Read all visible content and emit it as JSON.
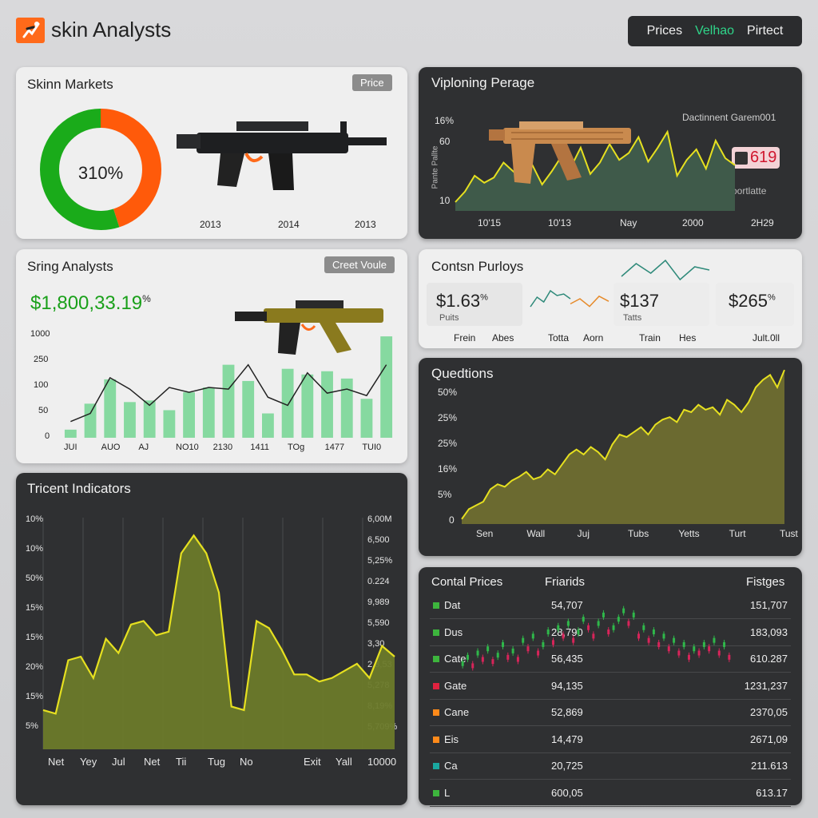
{
  "header": {
    "app_title": "skin Analysts",
    "logo_icon": "runner-logo-icon",
    "nav": [
      {
        "label": "Prices",
        "active": false
      },
      {
        "label": "Velhao",
        "active": true
      },
      {
        "label": "Pirtect",
        "active": false
      }
    ]
  },
  "skin_markets": {
    "title": "Skinn Markets",
    "button_label": "Price",
    "donut_value": "310%",
    "donut_segments": [
      {
        "name": "orange",
        "fraction": 0.45,
        "color": "#ff5a0a"
      },
      {
        "name": "green",
        "fraction": 0.55,
        "color": "#1aab1a"
      }
    ],
    "x_labels": [
      "2013",
      "2014",
      "2013"
    ]
  },
  "viploning": {
    "title": "Viploning Perage",
    "legend": "Dactinnent Garem001",
    "badge_value": "619",
    "sublabel": "Poortlatte",
    "vertical_label": "Pante Pallte",
    "y_ticks": [
      "16%",
      "60",
      "10"
    ],
    "x_ticks": [
      "10'15",
      "10'13",
      "Nay",
      "2000",
      "2H29"
    ],
    "values": [
      10,
      22,
      40,
      32,
      38,
      55,
      45,
      36,
      52,
      30,
      45,
      62,
      50,
      72,
      42,
      55,
      76,
      58,
      66,
      84,
      56,
      72,
      90,
      40,
      58,
      70,
      48,
      80,
      60,
      52
    ]
  },
  "string_analysts": {
    "title": "Sring Analysts",
    "button_label": "Creet Voule",
    "big_value": "$1,800,33.19",
    "big_value_suffix": "%",
    "y_ticks": [
      "1000",
      "250",
      "100",
      "50",
      "0"
    ],
    "x_ticks": [
      "JUI",
      "AUO",
      "AJ",
      "NO10",
      "2130",
      "1411",
      "TOg",
      "1477",
      "TUI0"
    ],
    "bars": [
      10,
      42,
      72,
      44,
      46,
      34,
      56,
      62,
      90,
      70,
      30,
      85,
      78,
      82,
      73,
      48,
      125
    ],
    "line": [
      20,
      30,
      74,
      60,
      40,
      62,
      56,
      62,
      60,
      90,
      50,
      40,
      80,
      55,
      60,
      52,
      90
    ]
  },
  "contsn_purloys": {
    "title": "Contsn Purloys",
    "stats": [
      {
        "value": "$1.63",
        "suffix": "%",
        "sub": "Puits",
        "foot_a": "Frein",
        "foot_b": "Abes"
      },
      {
        "value": "$137",
        "suffix": "",
        "sub": "Tatts",
        "foot_a": "Totta",
        "foot_b": "Aorn"
      },
      {
        "value": "$265",
        "suffix": "%",
        "sub": "",
        "foot_a": "Train",
        "foot_b": "Hes",
        "foot_c": "Jult.0ll"
      }
    ],
    "spark1": [
      4,
      12,
      6,
      14,
      2,
      10,
      8
    ],
    "spark2": [
      2,
      8,
      5,
      12,
      9,
      10,
      7
    ]
  },
  "quedtions": {
    "title": "Quedtions",
    "y_ticks": [
      "50%",
      "25%",
      "25%",
      "16%",
      "5%",
      "0"
    ],
    "x_ticks": [
      "Sen",
      "Wall",
      "Juj",
      "Tubs",
      "Yetts",
      "Turt",
      "Tust"
    ],
    "values": [
      4,
      12,
      15,
      18,
      28,
      32,
      30,
      35,
      38,
      42,
      36,
      38,
      44,
      40,
      48,
      56,
      60,
      56,
      62,
      58,
      52,
      64,
      72,
      70,
      74,
      78,
      72,
      80,
      84,
      86,
      82,
      92,
      90,
      96,
      92,
      94,
      88,
      100,
      96,
      90,
      98,
      110,
      116,
      120,
      110,
      124
    ]
  },
  "tricent": {
    "title": "Tricent Indicators",
    "y_ticks_left": [
      "10%",
      "10%",
      "50%",
      "15%",
      "15%",
      "20%",
      "15%",
      "5%"
    ],
    "y_ticks_right": [
      "6,00M",
      "6,500",
      "5,25%",
      "0.224",
      "9,989",
      "5,590",
      "3,30",
      "2,3,53",
      "5,278",
      "8,19%",
      "5,709%"
    ],
    "x_ticks": [
      "Net",
      "Yey",
      "Jul",
      "Net",
      "Tii",
      "Tug",
      "No",
      "Exit",
      "Yall",
      "10000"
    ],
    "values": [
      22,
      20,
      50,
      52,
      40,
      62,
      54,
      70,
      72,
      64,
      66,
      110,
      120,
      110,
      88,
      24,
      22,
      72,
      68,
      56,
      42,
      42,
      38,
      40,
      44,
      48,
      40,
      58,
      52
    ]
  },
  "contal_prices": {
    "title": "Contal Prices",
    "col2": "Friarids",
    "col3": "Fistges",
    "rows": [
      {
        "name": "Dat",
        "color": "#3db53d",
        "mid": "54,707",
        "right": "151,707"
      },
      {
        "name": "Dus",
        "color": "#3db53d",
        "mid": "28,790",
        "right": "183,093"
      },
      {
        "name": "Cate",
        "color": "#3db53d",
        "mid": "56,435",
        "right": "610.287"
      },
      {
        "name": "Gate",
        "color": "#e0223f",
        "mid": "94,135",
        "right": "1231,237"
      },
      {
        "name": "Cane",
        "color": "#ff8a1a",
        "mid": "52,869",
        "right": "2370,05"
      },
      {
        "name": "Eis",
        "color": "#ff8a1a",
        "mid": "14,479",
        "right": "2671,09"
      },
      {
        "name": "Ca",
        "color": "#1aa8a0",
        "mid": "20,725",
        "right": "211.613"
      },
      {
        "name": "L",
        "color": "#3db53d",
        "mid": "600,05",
        "right": "613.17"
      }
    ],
    "candles": [
      5,
      8,
      4,
      10,
      7,
      12,
      6,
      9,
      14,
      8,
      11,
      7,
      16,
      12,
      18,
      10,
      14,
      20,
      15,
      22,
      18,
      24,
      16,
      20,
      26,
      22,
      18,
      24,
      28,
      20,
      22,
      26,
      30,
      24,
      28,
      18,
      22,
      16,
      20,
      14,
      18,
      12,
      16,
      10,
      14,
      8,
      12,
      10,
      14,
      12,
      16,
      10,
      14,
      8
    ]
  },
  "colors": {
    "accent_green": "#2fd68a",
    "chart_yellow": "#e6e020",
    "fill_olive": "#7a8a2e",
    "bar_green": "#86d9a0"
  }
}
